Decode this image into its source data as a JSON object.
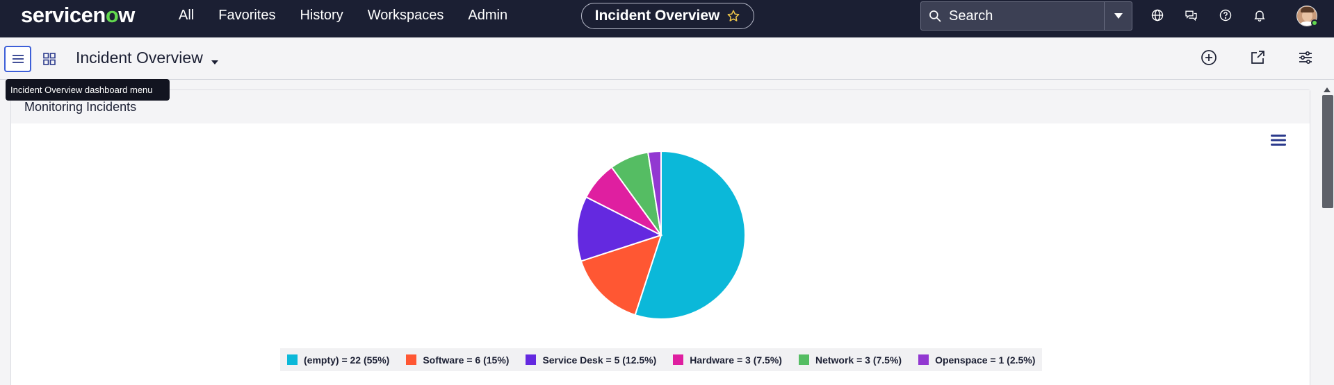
{
  "app": {
    "logo_text_pre": "servicen",
    "logo_text_o": "o",
    "logo_text_post": "w"
  },
  "nav": {
    "items": [
      "All",
      "Favorites",
      "History",
      "Workspaces",
      "Admin"
    ]
  },
  "title_pill": {
    "label": "Incident Overview",
    "icon": "star-icon"
  },
  "search": {
    "placeholder": "Search"
  },
  "top_icons": [
    "globe-icon",
    "chat-icon",
    "help-icon",
    "bell-icon"
  ],
  "dashboard": {
    "title": "Incident Overview",
    "tooltip": "Incident Overview dashboard menu"
  },
  "widget": {
    "title": "Monitoring Incidents"
  },
  "chart_data": {
    "type": "pie",
    "categories": [
      "(empty)",
      "Software",
      "Service Desk",
      "Hardware",
      "Network",
      "Openspace"
    ],
    "values": [
      22,
      6,
      5,
      3,
      3,
      1
    ],
    "percents": [
      "55%",
      "15%",
      "12.5%",
      "7.5%",
      "7.5%",
      "2.5%"
    ],
    "colors": [
      "#0bb8d9",
      "#ff5733",
      "#6429e0",
      "#df1fa0",
      "#55bd63",
      "#9238d1"
    ],
    "legend_labels": [
      "(empty) = 22 (55%)",
      "Software = 6 (15%)",
      "Service Desk = 5 (12.5%)",
      "Hardware = 3 (7.5%)",
      "Network = 3 (7.5%)",
      "Openspace = 1 (2.5%)"
    ],
    "legend_position": "bottom",
    "title": ""
  },
  "colors": {
    "topbar": "#1b1f33",
    "accent_green": "#62d84e",
    "focus_blue": "#3d5fd8"
  }
}
